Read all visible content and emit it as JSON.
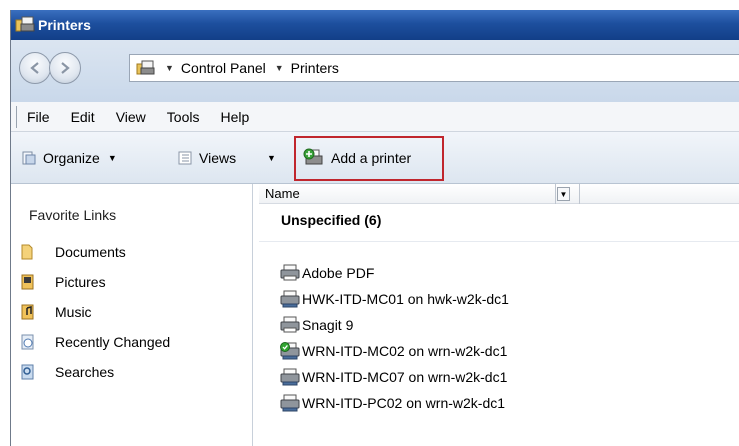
{
  "window": {
    "title": "Printers"
  },
  "address": {
    "crumbs": [
      "Control Panel",
      "Printers"
    ]
  },
  "menu": {
    "items": [
      "File",
      "Edit",
      "View",
      "Tools",
      "Help"
    ]
  },
  "toolbar": {
    "organize_label": "Organize",
    "views_label": "Views",
    "add_printer_label": "Add a printer",
    "highlight_color": "#c0262d"
  },
  "sidebar": {
    "title": "Favorite Links",
    "items": [
      {
        "label": "Documents",
        "icon": "documents-folder-icon"
      },
      {
        "label": "Pictures",
        "icon": "pictures-folder-icon"
      },
      {
        "label": "Music",
        "icon": "music-folder-icon"
      },
      {
        "label": "Recently Changed",
        "icon": "recently-changed-icon"
      },
      {
        "label": "Searches",
        "icon": "searches-folder-icon"
      }
    ]
  },
  "content": {
    "column_name": "Name",
    "group_header": "Unspecified (6)",
    "items": [
      {
        "label": "Adobe PDF",
        "icon": "printer-icon"
      },
      {
        "label": "HWK-ITD-MC01 on hwk-w2k-dc1",
        "icon": "network-printer-icon"
      },
      {
        "label": "Snagit 9",
        "icon": "printer-icon"
      },
      {
        "label": "WRN-ITD-MC02 on wrn-w2k-dc1",
        "icon": "default-network-printer-icon"
      },
      {
        "label": "WRN-ITD-MC07 on wrn-w2k-dc1",
        "icon": "network-printer-icon"
      },
      {
        "label": "WRN-ITD-PC02 on wrn-w2k-dc1",
        "icon": "network-printer-icon"
      }
    ]
  }
}
